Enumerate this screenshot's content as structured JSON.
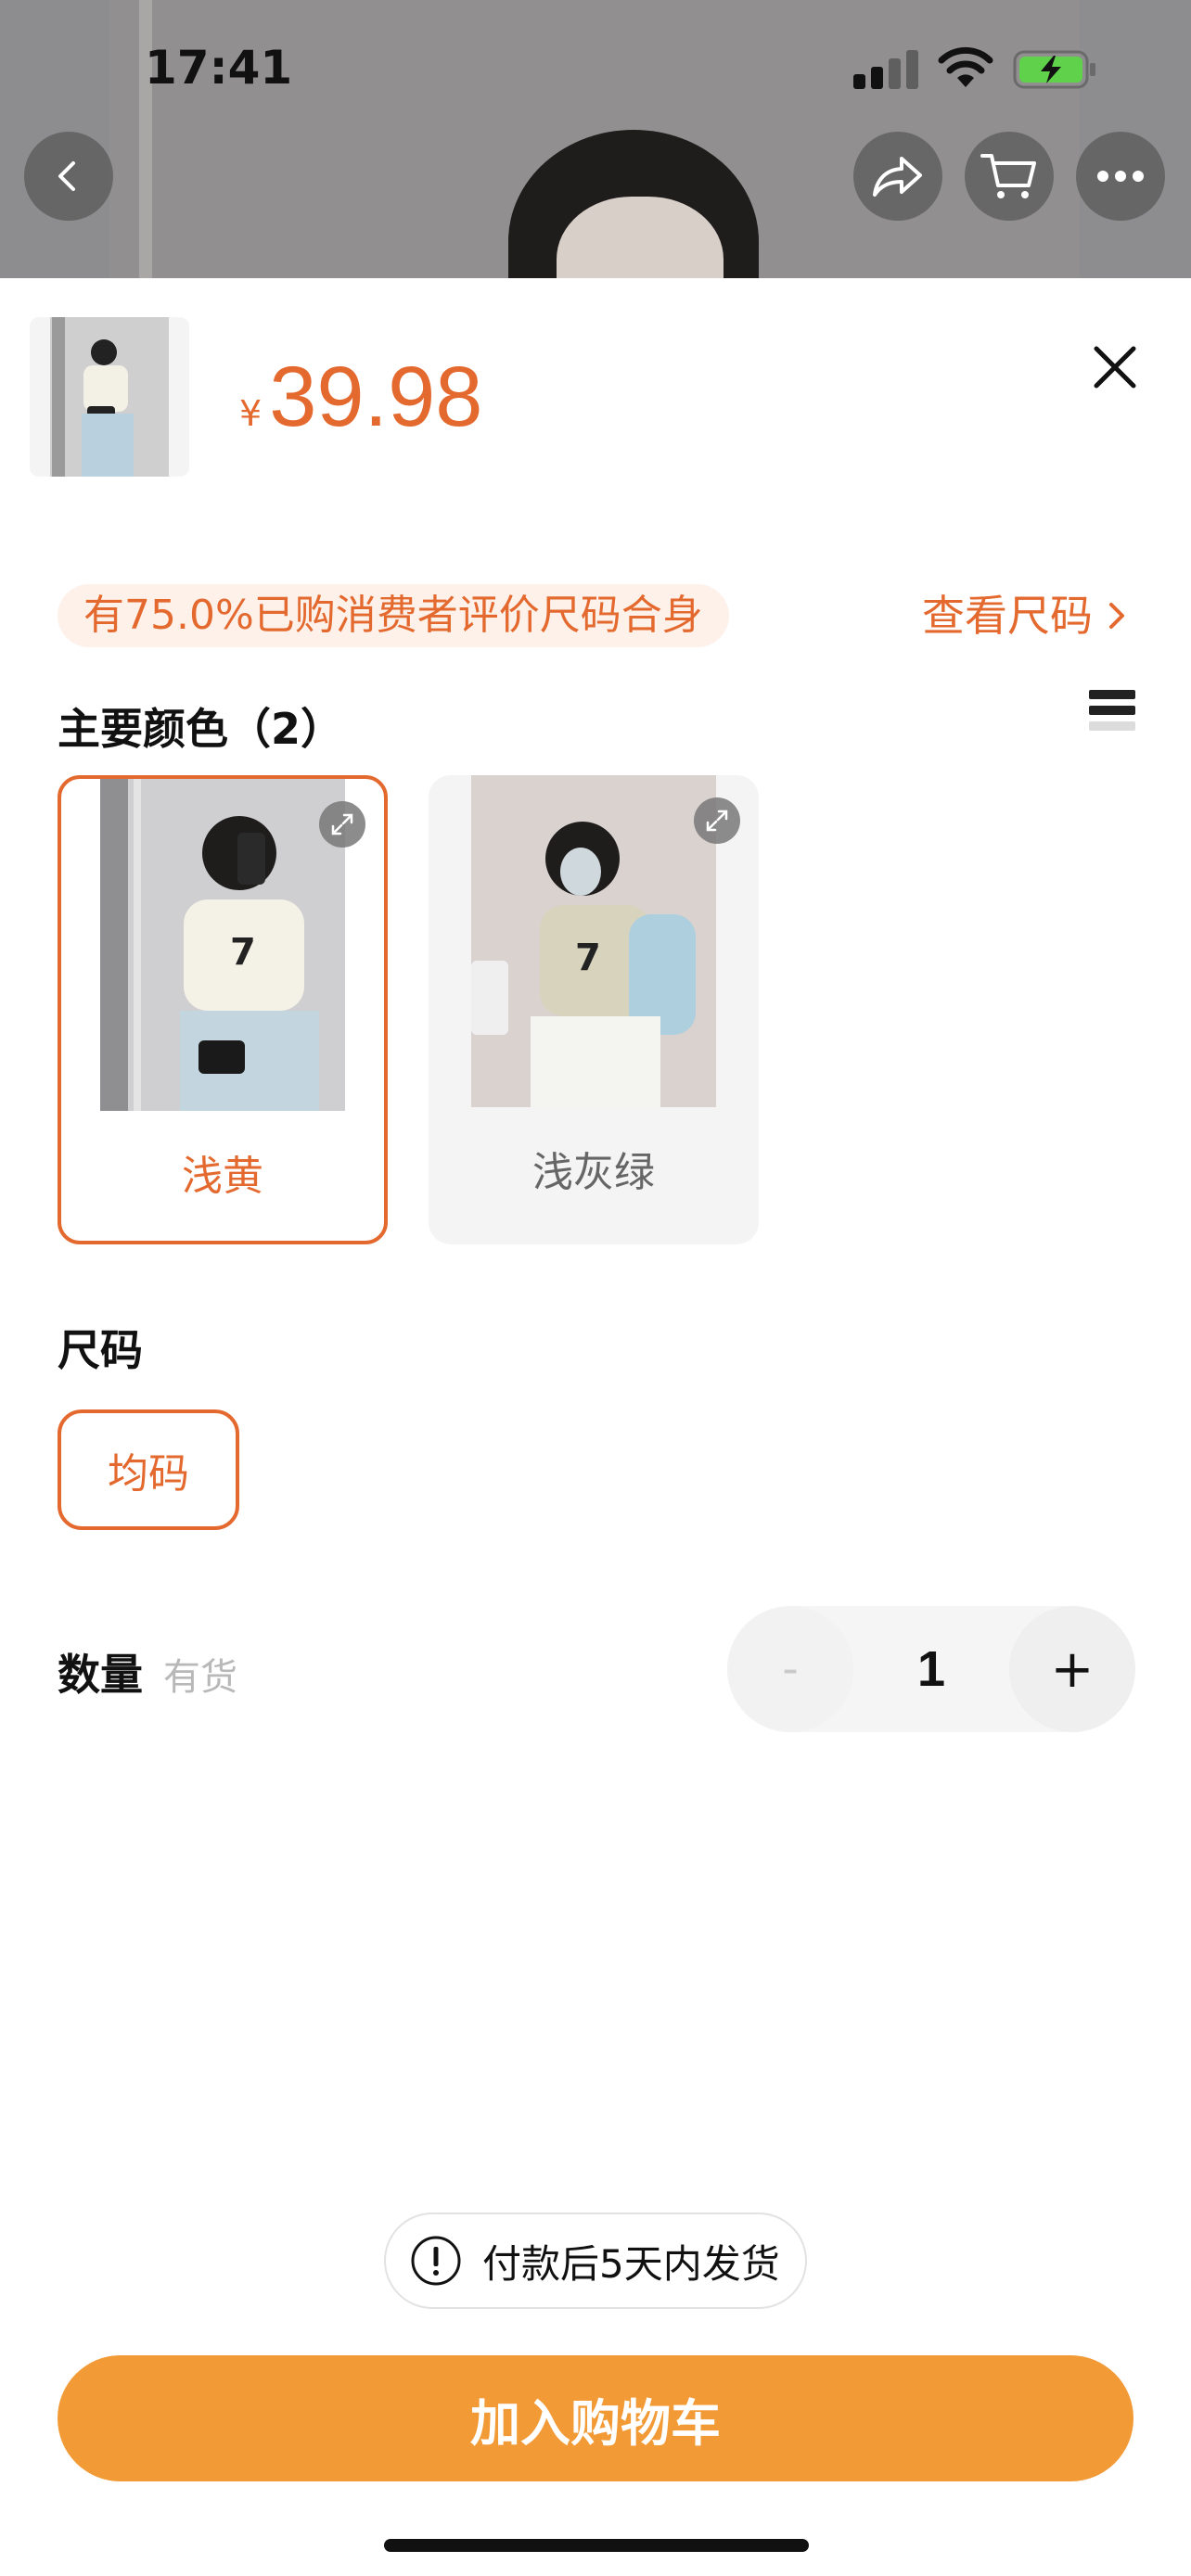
{
  "status_bar": {
    "time": "17:41"
  },
  "nav": {
    "back_icon": "chevron-left-icon",
    "share_icon": "share-icon",
    "cart_icon": "cart-icon",
    "more_icon": "more-icon"
  },
  "product": {
    "currency": "¥",
    "price": "39.98",
    "fit_notice": "有75.0%已购消费者评价尺码合身",
    "size_link": "查看尺码"
  },
  "colors": {
    "title": "主要颜色（2）",
    "options": [
      {
        "label": "浅黄",
        "selected": true
      },
      {
        "label": "浅灰绿",
        "selected": false
      }
    ]
  },
  "size": {
    "title": "尺码",
    "options": [
      {
        "label": "均码",
        "selected": true
      }
    ]
  },
  "quantity": {
    "title": "数量",
    "stock": "有货",
    "minus": "-",
    "value": "1",
    "plus": "+"
  },
  "shipping_note": "付款后5天内发货",
  "add_to_cart": "加入购物车",
  "theme": {
    "accent": "#e4692e",
    "button": "#f29a35"
  }
}
